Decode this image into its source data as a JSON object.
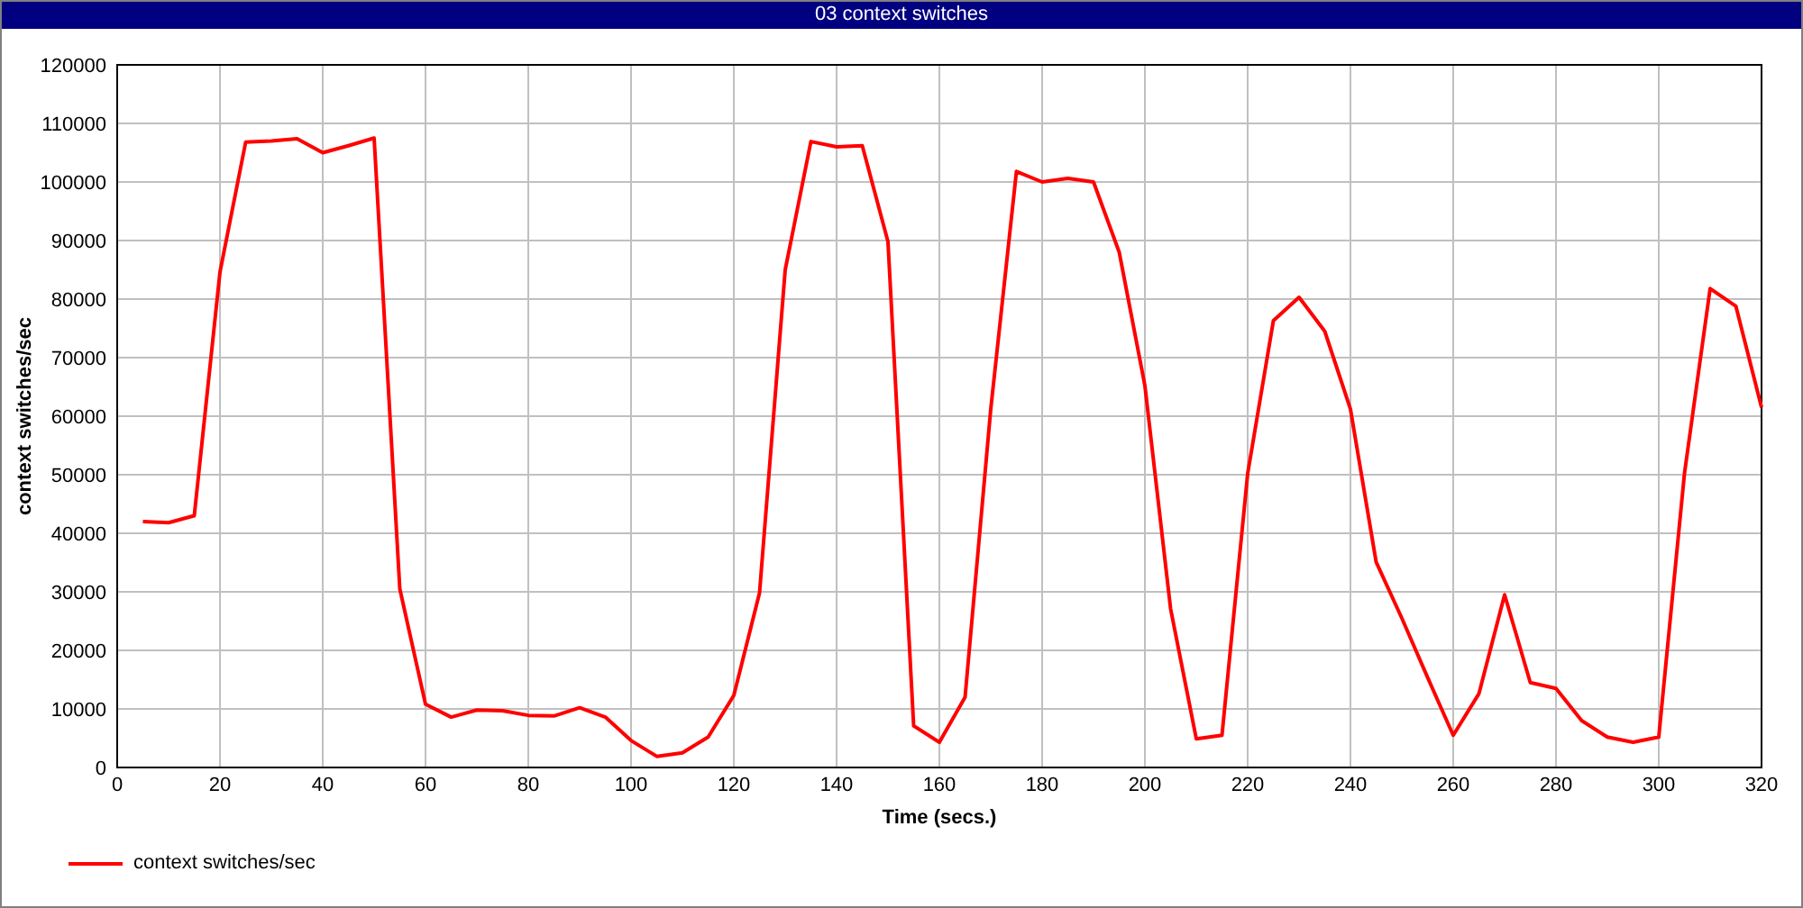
{
  "window": {
    "title": "03 context switches"
  },
  "chart": {
    "chart_data": {
      "type": "line",
      "xlabel": "Time (secs.)",
      "ylabel": "context switches/sec",
      "x": [
        5,
        10,
        15,
        20,
        25,
        30,
        35,
        40,
        45,
        50,
        55,
        60,
        65,
        70,
        75,
        80,
        85,
        90,
        95,
        100,
        105,
        110,
        115,
        120,
        125,
        130,
        135,
        140,
        145,
        150,
        155,
        160,
        165,
        170,
        175,
        180,
        185,
        190,
        195,
        200,
        205,
        210,
        215,
        220,
        225,
        230,
        235,
        240,
        245,
        250,
        255,
        260,
        265,
        270,
        275,
        280,
        285,
        290,
        295,
        300,
        305,
        310,
        315,
        320
      ],
      "series": [
        {
          "name": "context switches/sec",
          "color": "#ff0000",
          "values": [
            42000,
            41800,
            43000,
            84600,
            106800,
            107000,
            107400,
            105000,
            106200,
            107500,
            30500,
            10800,
            8600,
            9800,
            9700,
            8900,
            8800,
            10200,
            8600,
            4600,
            1900,
            2500,
            5200,
            12300,
            29800,
            85000,
            106900,
            106000,
            106200,
            89800,
            7100,
            4300,
            12000,
            61200,
            101800,
            100000,
            100600,
            100000,
            88000,
            65200,
            27100,
            4900,
            5500,
            50200,
            76300,
            80300,
            74500,
            61200,
            35100,
            25500,
            15400,
            5500,
            12600,
            29500,
            14500,
            13500,
            8000,
            5200,
            4300,
            5200,
            50200,
            81800,
            78800,
            61500
          ]
        }
      ],
      "grid": true,
      "xlim": [
        0,
        320
      ],
      "ylim": [
        0,
        120000
      ],
      "xticks": [
        0,
        20,
        40,
        60,
        80,
        100,
        120,
        140,
        160,
        180,
        200,
        220,
        240,
        260,
        280,
        300,
        320
      ],
      "yticks": [
        0,
        10000,
        20000,
        30000,
        40000,
        50000,
        60000,
        70000,
        80000,
        90000,
        100000,
        110000,
        120000
      ]
    }
  }
}
